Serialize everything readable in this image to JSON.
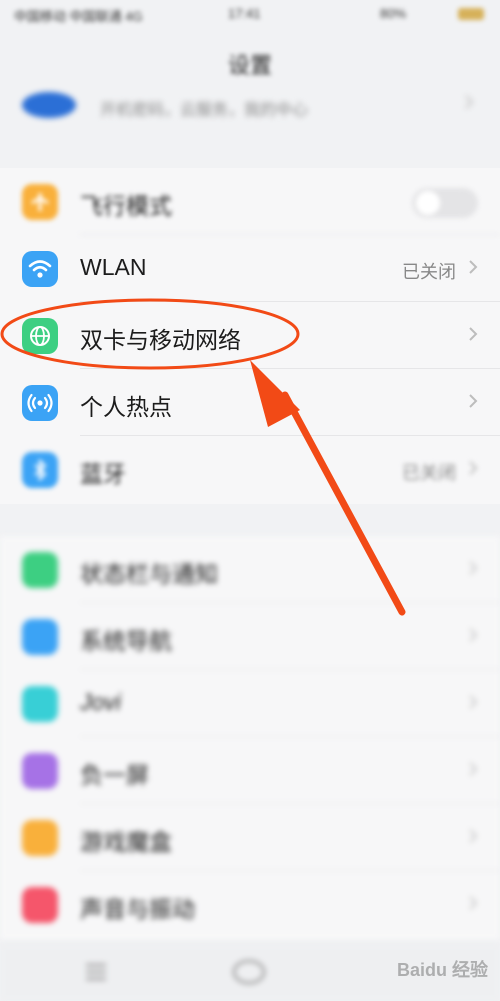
{
  "status_bar": {
    "carrier": "中国移动 中国联通 4G",
    "time": "17:41",
    "battery": "80%"
  },
  "page": {
    "title": "设置"
  },
  "account": {
    "subtitle": "开机密码，云服务，我的中心"
  },
  "group1": [
    {
      "label": "飞行模式",
      "value": "",
      "icon": "airplane-icon",
      "color": "#f9b03b",
      "toggle": true
    },
    {
      "label": "WLAN",
      "value": "已关闭",
      "icon": "wifi-icon",
      "color": "#3ba3f5",
      "toggle": false
    },
    {
      "label": "双卡与移动网络",
      "value": "",
      "icon": "globe-icon",
      "color": "#3dcf82",
      "toggle": false
    },
    {
      "label": "个人热点",
      "value": "",
      "icon": "hotspot-icon",
      "color": "#3ba3f5",
      "toggle": false
    },
    {
      "label": "蓝牙",
      "value": "已关闭",
      "icon": "bluetooth-icon",
      "color": "#3ba3f5",
      "toggle": false
    }
  ],
  "group2": [
    {
      "label": "状态栏与通知",
      "icon": "notification-icon",
      "color": "#3dcf82"
    },
    {
      "label": "系统导航",
      "icon": "navigation-icon",
      "color": "#3ba3f5"
    },
    {
      "label": "Jovi",
      "icon": "jovi-icon",
      "color": "#38cfd6"
    },
    {
      "label": "负一屏",
      "icon": "screen-icon",
      "color": "#a672e6"
    },
    {
      "label": "游戏魔盒",
      "icon": "game-icon",
      "color": "#f9b03b"
    },
    {
      "label": "声音与振动",
      "icon": "sound-icon",
      "color": "#f5566b"
    }
  ],
  "watermark": "Baidu 经验",
  "annotation": {
    "color": "#f24a16"
  }
}
